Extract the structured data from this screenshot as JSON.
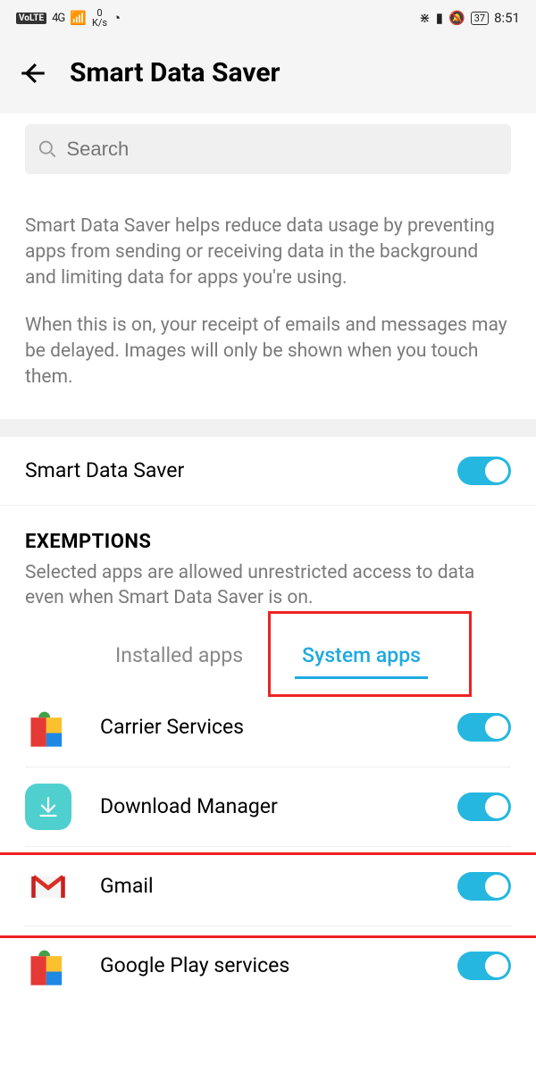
{
  "status": {
    "volte": "VoLTE",
    "net": "4G",
    "speed_top": "0",
    "speed_unit": "K/s",
    "battery": "37",
    "time": "8:51"
  },
  "header": {
    "title": "Smart Data Saver"
  },
  "search": {
    "placeholder": "Search"
  },
  "description": {
    "p1": "Smart Data Saver helps reduce data usage by preventing apps from sending or receiving data in the background and limiting data for apps you're using.",
    "p2": "When this is on, your receipt of emails and messages may be delayed. Images will only be shown when you touch them."
  },
  "master_toggle": {
    "label": "Smart Data Saver",
    "on": true
  },
  "exemptions": {
    "title": "EXEMPTIONS",
    "subtitle": "Selected apps are allowed unrestricted access to data even when Smart Data Saver is on."
  },
  "tabs": {
    "installed": "Installed apps",
    "system": "System apps"
  },
  "apps": [
    {
      "name": "Carrier Services",
      "on": true
    },
    {
      "name": "Download Manager",
      "on": true
    },
    {
      "name": "Gmail",
      "on": true
    },
    {
      "name": "Google Play services",
      "on": true
    }
  ]
}
